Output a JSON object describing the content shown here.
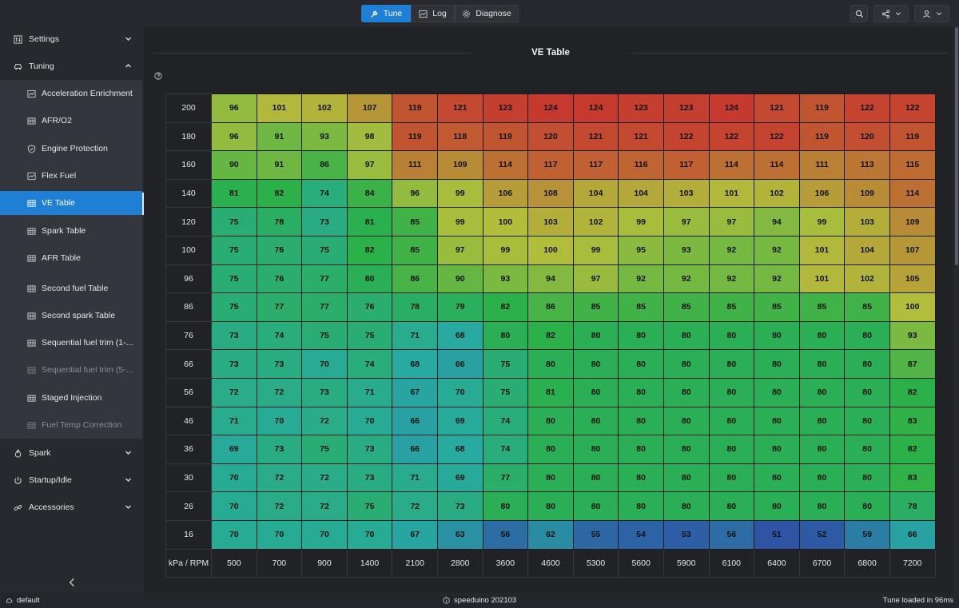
{
  "toolbar": {
    "tabs": [
      {
        "label": "Tune",
        "icon": "wrench-icon",
        "active": true
      },
      {
        "label": "Log",
        "icon": "chart-icon",
        "active": false
      },
      {
        "label": "Diagnose",
        "icon": "gear-icon",
        "active": false
      }
    ],
    "right_buttons": [
      "search-icon",
      "share-icon",
      "user-icon"
    ]
  },
  "sidebar": {
    "groups": [
      {
        "label": "Settings",
        "icon": "settings-icon",
        "expanded": false
      },
      {
        "label": "Tuning",
        "icon": "car-icon",
        "expanded": true
      },
      {
        "label": "Spark",
        "icon": "flame-icon",
        "expanded": false
      },
      {
        "label": "Startup/Idle",
        "icon": "power-icon",
        "expanded": false
      },
      {
        "label": "Accessories",
        "icon": "link-icon",
        "expanded": false
      }
    ],
    "tuning_items": [
      {
        "label": "Acceleration Enrichment",
        "icon": "chart-icon",
        "disabled": false
      },
      {
        "label": "AFR/O2",
        "icon": "table-icon",
        "disabled": false
      },
      {
        "label": "Engine Protection",
        "icon": "shield-icon",
        "disabled": false
      },
      {
        "label": "Flex Fuel",
        "icon": "chart-icon",
        "disabled": false
      },
      {
        "label": "VE Table",
        "icon": "table-icon",
        "disabled": false,
        "active": true
      },
      {
        "label": "Spark Table",
        "icon": "table-icon",
        "disabled": false
      },
      {
        "label": "AFR Table",
        "icon": "table-icon",
        "disabled": false
      },
      {
        "label": "Second fuel Table",
        "icon": "table-icon",
        "disabled": false
      },
      {
        "label": "Second spark Table",
        "icon": "table-icon",
        "disabled": false
      },
      {
        "label": "Sequential fuel trim (1-...",
        "icon": "table-icon",
        "disabled": false
      },
      {
        "label": "Sequential fuel trim (5-...",
        "icon": "table-icon",
        "disabled": true
      },
      {
        "label": "Staged Injection",
        "icon": "table-icon",
        "disabled": false
      },
      {
        "label": "Fuel Temp Correction",
        "icon": "table-icon",
        "disabled": true
      }
    ]
  },
  "main": {
    "title": "VE Table",
    "axis_label": "kPa / RPM",
    "rows": [
      "200",
      "180",
      "160",
      "140",
      "120",
      "100",
      "96",
      "86",
      "76",
      "66",
      "56",
      "46",
      "36",
      "30",
      "26",
      "16"
    ],
    "cols": [
      "500",
      "700",
      "900",
      "1400",
      "2100",
      "2800",
      "3600",
      "4600",
      "5300",
      "5600",
      "5900",
      "6100",
      "6400",
      "6700",
      "6800",
      "7200"
    ],
    "values": [
      [
        96,
        101,
        102,
        107,
        119,
        121,
        123,
        124,
        124,
        123,
        123,
        124,
        121,
        119,
        122,
        122
      ],
      [
        96,
        91,
        93,
        98,
        119,
        118,
        119,
        120,
        121,
        121,
        122,
        122,
        122,
        119,
        120,
        119
      ],
      [
        90,
        91,
        86,
        97,
        111,
        109,
        114,
        117,
        117,
        116,
        117,
        114,
        114,
        111,
        113,
        115
      ],
      [
        81,
        82,
        74,
        84,
        96,
        99,
        106,
        108,
        104,
        104,
        103,
        101,
        102,
        106,
        109,
        114
      ],
      [
        75,
        78,
        73,
        81,
        85,
        99,
        100,
        103,
        102,
        99,
        97,
        97,
        94,
        99,
        103,
        109
      ],
      [
        75,
        76,
        75,
        82,
        85,
        97,
        99,
        100,
        99,
        95,
        93,
        92,
        92,
        101,
        104,
        107
      ],
      [
        75,
        76,
        77,
        80,
        86,
        90,
        93,
        94,
        97,
        92,
        92,
        92,
        92,
        101,
        102,
        105
      ],
      [
        75,
        77,
        77,
        76,
        78,
        79,
        82,
        86,
        85,
        85,
        85,
        85,
        85,
        85,
        85,
        100
      ],
      [
        73,
        74,
        75,
        75,
        71,
        68,
        80,
        82,
        80,
        80,
        80,
        80,
        80,
        80,
        80,
        93
      ],
      [
        73,
        73,
        70,
        74,
        68,
        66,
        75,
        80,
        80,
        80,
        80,
        80,
        80,
        80,
        80,
        87
      ],
      [
        72,
        72,
        73,
        71,
        67,
        70,
        75,
        81,
        80,
        80,
        80,
        80,
        80,
        80,
        80,
        82
      ],
      [
        71,
        70,
        72,
        70,
        66,
        69,
        74,
        80,
        80,
        80,
        80,
        80,
        80,
        80,
        80,
        83
      ],
      [
        69,
        73,
        75,
        73,
        66,
        68,
        74,
        80,
        80,
        80,
        80,
        80,
        80,
        80,
        80,
        82
      ],
      [
        70,
        72,
        72,
        73,
        71,
        69,
        77,
        80,
        80,
        80,
        80,
        80,
        80,
        80,
        80,
        83
      ],
      [
        70,
        72,
        72,
        75,
        72,
        73,
        80,
        80,
        80,
        80,
        80,
        80,
        80,
        80,
        80,
        78
      ],
      [
        70,
        70,
        70,
        70,
        67,
        63,
        56,
        62,
        55,
        54,
        53,
        56,
        51,
        52,
        59,
        66
      ]
    ]
  },
  "status": {
    "profile": "default",
    "firmware": "speeduino 202103",
    "load_message": "Tune loaded in 96ms"
  },
  "colors": {
    "accent": "#1e7fd4",
    "low": "#2f4fa6",
    "mid": "#2bb04a",
    "high": "#c6392f"
  }
}
